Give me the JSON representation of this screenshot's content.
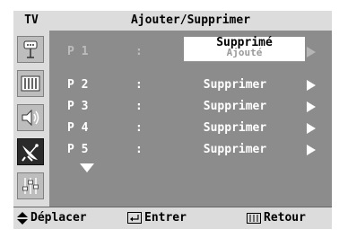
{
  "header": {
    "source_label": "TV",
    "title": "Ajouter/Supprimer"
  },
  "sidebar": {
    "items": [
      {
        "icon": "antenna-input-icon",
        "active": false
      },
      {
        "icon": "picture-icon",
        "active": false
      },
      {
        "icon": "sound-icon",
        "active": false
      },
      {
        "icon": "channel-satellite-icon",
        "active": true
      },
      {
        "icon": "setup-sliders-icon",
        "active": false
      }
    ]
  },
  "rows": [
    {
      "program": "P 1",
      "colon": ":",
      "value": "",
      "dimmed": true
    },
    {
      "program": "P 2",
      "colon": ":",
      "value": "Supprimer",
      "dimmed": false
    },
    {
      "program": "P 3",
      "colon": ":",
      "value": "Supprimer",
      "dimmed": false
    },
    {
      "program": "P 4",
      "colon": ":",
      "value": "Supprimer",
      "dimmed": false
    },
    {
      "program": "P 5",
      "colon": ":",
      "value": "Supprimer",
      "dimmed": false
    }
  ],
  "popup": {
    "selected_option": "Supprimé",
    "other_option": "Ajouté"
  },
  "footer": {
    "move_label": "Déplacer",
    "enter_label": "Entrer",
    "return_label": "Retour"
  },
  "colors": {
    "panel": "#8c8c8c",
    "bars": "#dcdcdc",
    "active_icon": "#2a2a2a",
    "text": "#ffffff"
  }
}
